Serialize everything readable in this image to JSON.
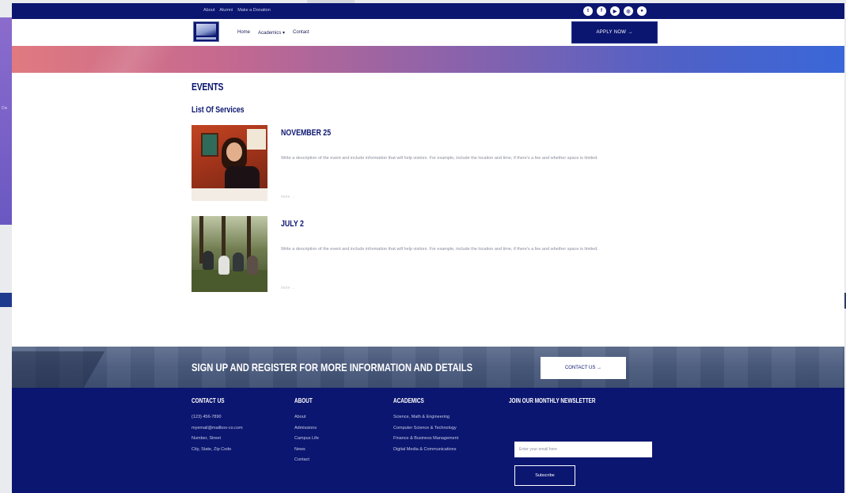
{
  "topbar": {
    "links": [
      "About",
      "Alumni",
      "Make a Donation"
    ],
    "social": [
      {
        "icon": "twitter-icon",
        "glyph": "t"
      },
      {
        "icon": "facebook-icon",
        "glyph": "f"
      },
      {
        "icon": "youtube-icon",
        "glyph": "▶"
      },
      {
        "icon": "instagram-icon",
        "glyph": "◎"
      },
      {
        "icon": "video-icon",
        "glyph": "●"
      }
    ]
  },
  "nav": {
    "links": [
      "Home",
      "Academics ▾",
      "Contact"
    ],
    "apply_label": "APPLY NOW →"
  },
  "events": {
    "title": "EVENTS",
    "subtitle": "List Of Services",
    "items": [
      {
        "date": "NOVEMBER 25",
        "description": "Write a description of the event and include information that will help visitors. For example, include the location and time, if there's a fee and whether space is limited.",
        "more": "more →"
      },
      {
        "date": "JULY 2",
        "description": "Write a description of the event and include information that will help visitors. For example, include the location and time, if there's a fee and whether space is limited.",
        "more": "more →"
      }
    ]
  },
  "signup": {
    "text": "SIGN UP AND REGISTER FOR MORE INFORMATION AND DETAILS",
    "contact_label": "CONTACT US →"
  },
  "footer": {
    "contact": {
      "heading": "CONTACT US",
      "items": [
        "(123) 456-7890",
        "myemail@mailbox-co.com",
        "Number, Street",
        "City, State, Zip Code"
      ]
    },
    "about": {
      "heading": "ABOUT",
      "items": [
        "About",
        "Admissions",
        "Campus Life",
        "News",
        "Contact"
      ]
    },
    "academics": {
      "heading": "ACADEMICS",
      "items": [
        "Science, Math & Engineering",
        "Computer Science & Technology",
        "Finance & Business Management",
        "Digital Media & Communications"
      ]
    },
    "newsletter": {
      "heading": "JOIN OUR MONTHLY NEWSLETTER",
      "placeholder": "Enter your email here",
      "subscribe_label": "Subscribe"
    }
  },
  "colors": {
    "navy": "#0b1670",
    "white": "#ffffff"
  }
}
